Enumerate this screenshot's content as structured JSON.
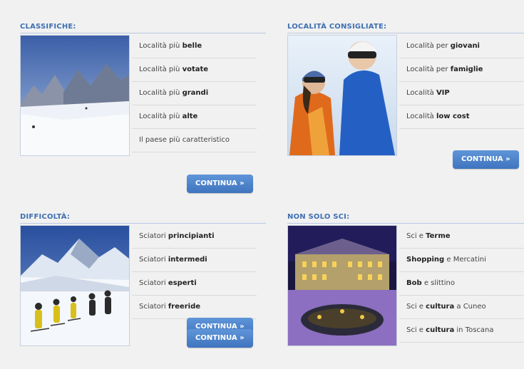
{
  "panels": [
    {
      "title": "CLASSIFICHE:",
      "image": "mountain-ski-slope",
      "items": [
        {
          "pre": "Località più ",
          "bold": "belle",
          "post": ""
        },
        {
          "pre": "Località più ",
          "bold": "votate",
          "post": ""
        },
        {
          "pre": "Località più ",
          "bold": "grandi",
          "post": ""
        },
        {
          "pre": "Località più ",
          "bold": "alte",
          "post": ""
        },
        {
          "pre": "Il paese più caratteristico",
          "bold": "",
          "post": ""
        }
      ],
      "button": "CONTINUA »"
    },
    {
      "title": "LOCALITÀ CONSIGLIATE:",
      "image": "couple-skiers",
      "items": [
        {
          "pre": "Località per ",
          "bold": "giovani",
          "post": ""
        },
        {
          "pre": "Località per ",
          "bold": "famiglie",
          "post": ""
        },
        {
          "pre": "Località ",
          "bold": "VIP",
          "post": ""
        },
        {
          "pre": "Località ",
          "bold": "low cost",
          "post": ""
        }
      ],
      "button": "CONTINUA »"
    },
    {
      "title": "DIFFICOLTÀ:",
      "image": "skiers-group",
      "items": [
        {
          "pre": "Sciatori ",
          "bold": "principianti",
          "post": ""
        },
        {
          "pre": "Sciatori ",
          "bold": "intermedi",
          "post": ""
        },
        {
          "pre": "Sciatori ",
          "bold": "esperti",
          "post": ""
        },
        {
          "pre": "Sciatori ",
          "bold": "freeride",
          "post": ""
        }
      ],
      "button": "CONTINUA »"
    },
    {
      "title": "NON SOLO SCI:",
      "image": "spa-night",
      "items": [
        {
          "pre": "Sci e ",
          "bold": "Terme",
          "post": ""
        },
        {
          "pre": "",
          "bold": "Shopping",
          "post": " e Mercatini"
        },
        {
          "pre": "",
          "bold": "Bob",
          "post": " e slittino"
        },
        {
          "pre": "Sci e ",
          "bold": "cultura",
          "post": " a Cuneo"
        },
        {
          "pre": "Sci e ",
          "bold": "cultura",
          "post": " in Toscana"
        }
      ],
      "button": ""
    }
  ],
  "colors": {
    "title": "#3f6fb1",
    "button": "#4a80c9",
    "background": "#f1f1f1"
  }
}
